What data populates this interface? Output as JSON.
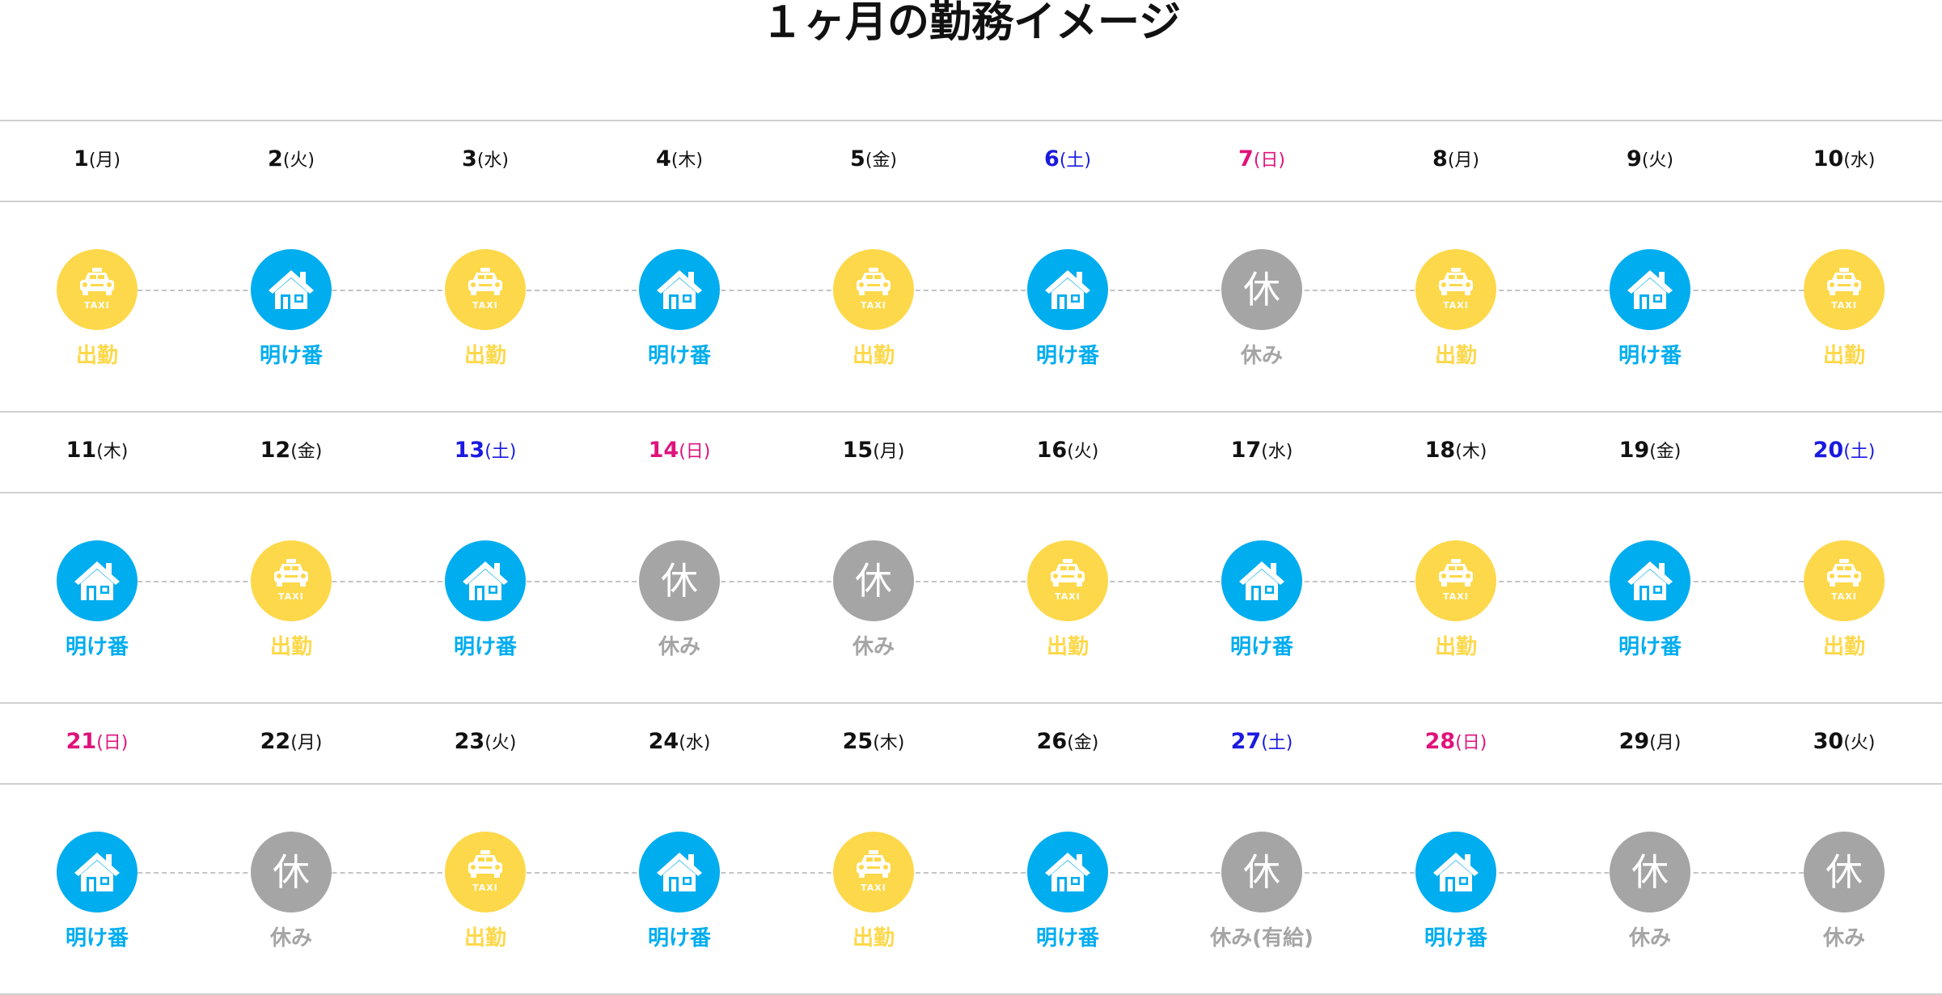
{
  "title": "１ヶ月の勤務イメージ",
  "colors": {
    "work": "#fdd84a",
    "after_shift": "#00adef",
    "off": "#a5a5a5",
    "saturday": "#1a1ae0",
    "sunday": "#e0137b"
  },
  "icon_glyphs": {
    "work": "taxi-icon",
    "after_shift": "house-icon",
    "off": "休"
  },
  "taxi_sign": "TAXI",
  "days": [
    {
      "date": "1",
      "dow": "(月)",
      "type": "work",
      "label": "出勤"
    },
    {
      "date": "2",
      "dow": "(火)",
      "type": "after_shift",
      "label": "明け番"
    },
    {
      "date": "3",
      "dow": "(水)",
      "type": "work",
      "label": "出勤"
    },
    {
      "date": "4",
      "dow": "(木)",
      "type": "after_shift",
      "label": "明け番"
    },
    {
      "date": "5",
      "dow": "(金)",
      "type": "work",
      "label": "出勤"
    },
    {
      "date": "6",
      "dow": "(土)",
      "type": "after_shift",
      "label": "明け番"
    },
    {
      "date": "7",
      "dow": "(日)",
      "type": "off",
      "label": "休み"
    },
    {
      "date": "8",
      "dow": "(月)",
      "type": "work",
      "label": "出勤"
    },
    {
      "date": "9",
      "dow": "(火)",
      "type": "after_shift",
      "label": "明け番"
    },
    {
      "date": "10",
      "dow": "(水)",
      "type": "work",
      "label": "出勤"
    },
    {
      "date": "11",
      "dow": "(木)",
      "type": "after_shift",
      "label": "明け番"
    },
    {
      "date": "12",
      "dow": "(金)",
      "type": "work",
      "label": "出勤"
    },
    {
      "date": "13",
      "dow": "(土)",
      "type": "after_shift",
      "label": "明け番"
    },
    {
      "date": "14",
      "dow": "(日)",
      "type": "off",
      "label": "休み"
    },
    {
      "date": "15",
      "dow": "(月)",
      "type": "off",
      "label": "休み"
    },
    {
      "date": "16",
      "dow": "(火)",
      "type": "work",
      "label": "出勤"
    },
    {
      "date": "17",
      "dow": "(水)",
      "type": "after_shift",
      "label": "明け番"
    },
    {
      "date": "18",
      "dow": "(木)",
      "type": "work",
      "label": "出勤"
    },
    {
      "date": "19",
      "dow": "(金)",
      "type": "after_shift",
      "label": "明け番"
    },
    {
      "date": "20",
      "dow": "(土)",
      "type": "work",
      "label": "出勤"
    },
    {
      "date": "21",
      "dow": "(日)",
      "type": "after_shift",
      "label": "明け番"
    },
    {
      "date": "22",
      "dow": "(月)",
      "type": "off",
      "label": "休み"
    },
    {
      "date": "23",
      "dow": "(火)",
      "type": "work",
      "label": "出勤"
    },
    {
      "date": "24",
      "dow": "(水)",
      "type": "after_shift",
      "label": "明け番"
    },
    {
      "date": "25",
      "dow": "(木)",
      "type": "work",
      "label": "出勤"
    },
    {
      "date": "26",
      "dow": "(金)",
      "type": "after_shift",
      "label": "明け番"
    },
    {
      "date": "27",
      "dow": "(土)",
      "type": "off",
      "label": "休み(有給)"
    },
    {
      "date": "28",
      "dow": "(日)",
      "type": "after_shift",
      "label": "明け番"
    },
    {
      "date": "29",
      "dow": "(月)",
      "type": "off",
      "label": "休み"
    },
    {
      "date": "30",
      "dow": "(火)",
      "type": "off",
      "label": "休み"
    }
  ]
}
